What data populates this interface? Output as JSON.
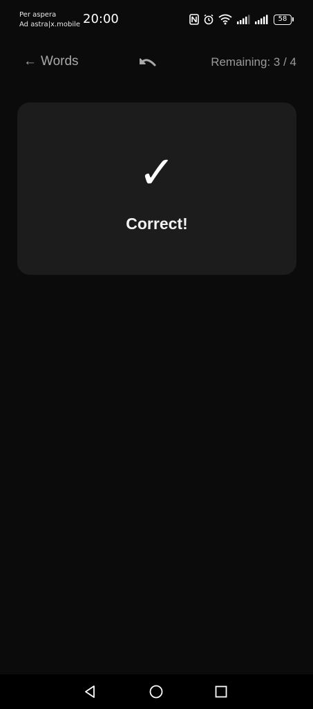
{
  "status_bar": {
    "carrier_line1": "Per aspera",
    "carrier_line2": "Ad astra|x.mobile",
    "time": "20:00",
    "battery": "58",
    "icons": [
      "nfc-icon",
      "alarm-icon",
      "wifi-icon",
      "signal-icon",
      "signal-icon",
      "battery-icon"
    ]
  },
  "header": {
    "back_arrow": "←",
    "back_label": "Words",
    "undo_icon": "undo-icon",
    "remaining_text": "Remaining: 3 / 4"
  },
  "card": {
    "check_mark": "✓",
    "result_text": "Correct!"
  },
  "nav_bar": {
    "icons": [
      "back-triangle-icon",
      "home-circle-icon",
      "recents-square-icon"
    ]
  }
}
